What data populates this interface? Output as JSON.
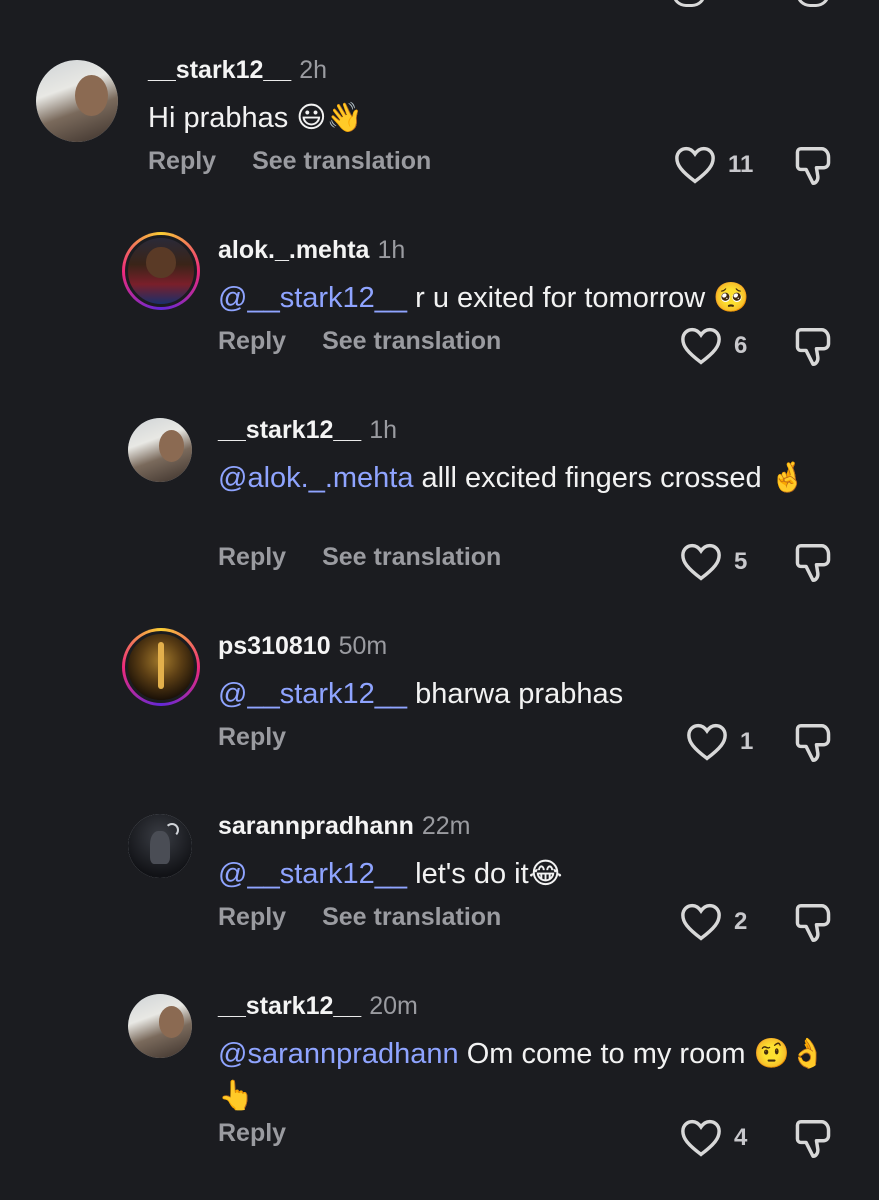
{
  "comments": [
    {
      "username": "__stark12__",
      "time": "2h",
      "mention": "",
      "text": "Hi prabhas 😃👋",
      "actions": [
        "Reply",
        "See translation"
      ],
      "likes": "11"
    },
    {
      "username": "alok._.mehta",
      "time": "1h",
      "mention": "@__stark12__",
      "text": " r u exited for tomorrow 🥺",
      "actions": [
        "Reply",
        "See translation"
      ],
      "likes": "6"
    },
    {
      "username": "__stark12__",
      "time": "1h",
      "mention": "@alok._.mehta",
      "text": " alll excited fingers crossed 🤞",
      "actions": [
        "Reply",
        "See translation"
      ],
      "likes": "5"
    },
    {
      "username": "ps310810",
      "time": "50m",
      "mention": "@__stark12__",
      "text": " bharwa prabhas",
      "actions": [
        "Reply"
      ],
      "likes": "1"
    },
    {
      "username": "sarannpradhann",
      "time": "22m",
      "mention": "@__stark12__",
      "text": " let's do it😂",
      "actions": [
        "Reply",
        "See translation"
      ],
      "likes": "2"
    },
    {
      "username": "__stark12__",
      "time": "20m",
      "mention": "@sarannpradhann",
      "text": " Om come to my room 🤨👌👆",
      "actions": [
        "Reply"
      ],
      "likes": "4"
    }
  ],
  "icons": {
    "like": "heart-icon",
    "dislike": "thumbs-down-icon",
    "mention_prefix": "threads-at-icon"
  },
  "colors": {
    "background": "#1b1c20",
    "mention": "#8fa4ff",
    "muted": "#9a9ba0"
  }
}
